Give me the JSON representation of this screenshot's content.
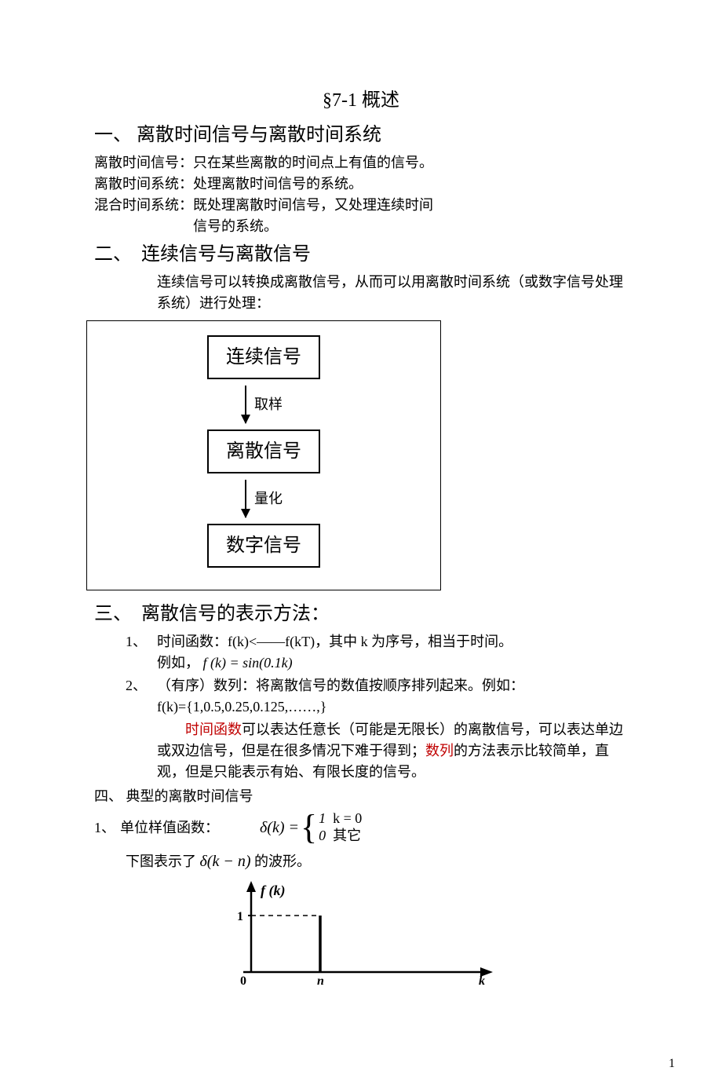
{
  "title": "§7-1  概述",
  "h1": {
    "label": "一、 离散时间信号与离散时间系统",
    "def1_label": "离散时间信号：",
    "def1_text": "只在某些离散的时间点上有值的信号。",
    "def2_label": "离散时间系统：",
    "def2_text": "处理离散时间信号的系统。",
    "def3_label": "混合时间系统：",
    "def3_text": "既处理离散时间信号，又处理连续时间信号的系统。"
  },
  "h2": {
    "label": "二、　连续信号与离散信号",
    "intro": "连续信号可以转换成离散信号，从而可以用离散时间系统（或数字信号处理系统）进行处理："
  },
  "flow": {
    "box1": "连续信号",
    "arrow1": "取样",
    "box2": "离散信号",
    "arrow2": "量化",
    "box3": "数字信号"
  },
  "h3": {
    "label": "三、　离散信号的表示方法：",
    "item1_marker": "1、",
    "item1_line1": "时间函数：f(k)<——f(kT)，其中 k 为序号，相当于时间。",
    "item1_line2_prefix": "例如，",
    "item1_formula": "f (k) = sin(0.1k)",
    "item2_marker": "2、",
    "item2_line1": "（有序）数列：将离散信号的数值按顺序排列起来。例如：",
    "item2_line2": "f(k)={1,0.5,0.25,0.125,……,}",
    "note_red1": "时间函数",
    "note_mid1": "可以表达任意长（可能是无限长）的离散信号，可以表达单边或双边信号，但是在很多情况下难于得到；",
    "note_red2": "数列",
    "note_mid2": "的方法表示比较简单，直观，但是只能表示有始、有限长度的信号。"
  },
  "h4": {
    "label": "四、 典型的离散时间信号",
    "item1_marker": "1、",
    "item1_label": "单位样值函数：",
    "delta_lhs": "δ(k) =",
    "case1_val": "1",
    "case1_cond": "k = 0",
    "case2_val": "0",
    "case2_cond": "其它",
    "line2_prefix": "下图表示了",
    "line2_formula": "δ(k − n)",
    "line2_suffix": "的波形。"
  },
  "graph": {
    "ylabel": "f (k)",
    "ytick": "1",
    "origin": "0",
    "xtick": "n",
    "xlabel": "k"
  },
  "page_number": "1"
}
